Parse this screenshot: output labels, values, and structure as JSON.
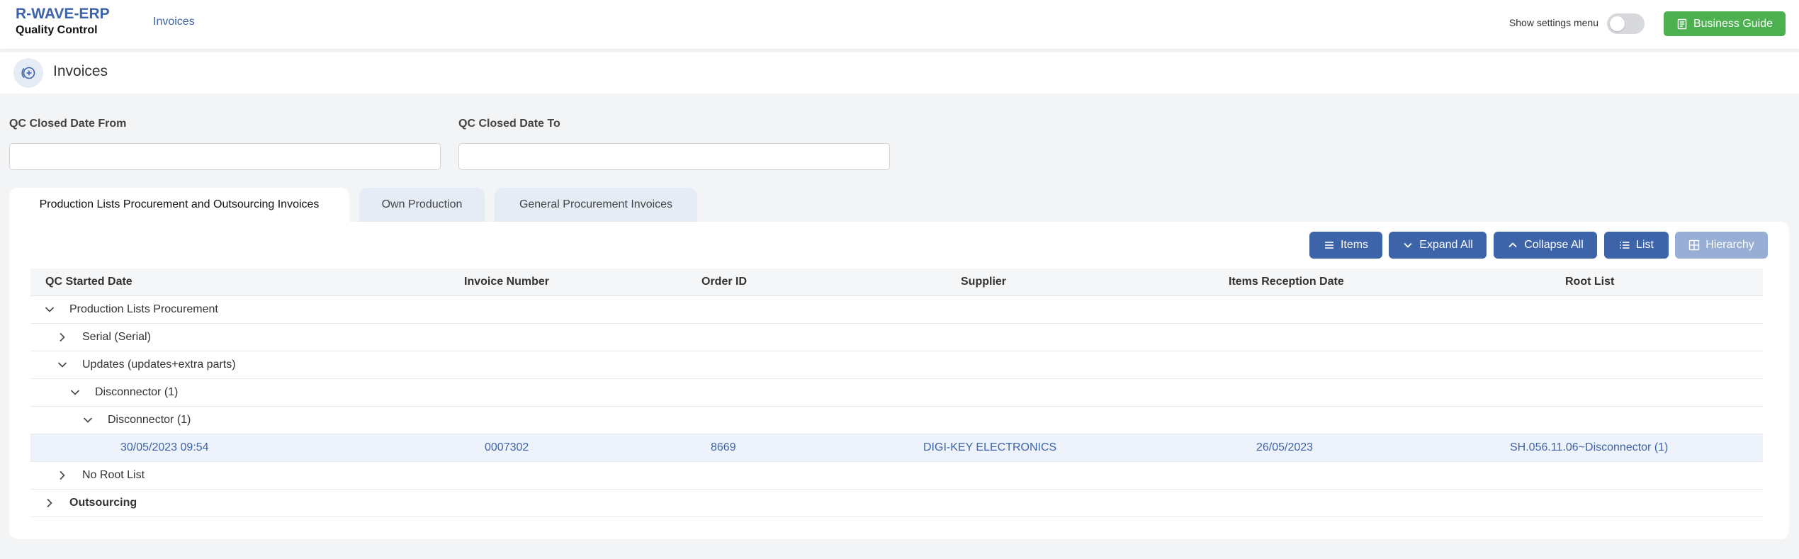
{
  "header": {
    "brand_name": "R-WAVE-ERP",
    "brand_sub": "Quality Control",
    "nav_invoices": "Invoices",
    "settings_label": "Show settings menu",
    "guide_button": "Business Guide"
  },
  "page": {
    "title": "Invoices"
  },
  "filters": {
    "date_from_label": "QC Closed Date From",
    "date_to_label": "QC Closed Date To",
    "date_from_value": "",
    "date_to_value": ""
  },
  "tabs": [
    {
      "label": "Production Lists Procurement and Outsourcing Invoices",
      "active": true
    },
    {
      "label": "Own Production",
      "active": false
    },
    {
      "label": "General Procurement Invoices",
      "active": false
    }
  ],
  "toolbar": {
    "items": "Items",
    "expand_all": "Expand All",
    "collapse_all": "Collapse All",
    "list": "List",
    "hierarchy": "Hierarchy"
  },
  "table": {
    "columns": [
      "QC Started Date",
      "Invoice Number",
      "Order ID",
      "Supplier",
      "Items Reception Date",
      "Root List"
    ],
    "groups": [
      {
        "label": "Production Lists Procurement",
        "expanded": true
      },
      {
        "label": "Serial (Serial)",
        "expanded": false
      },
      {
        "label": "Updates (updates+extra parts)",
        "expanded": true
      },
      {
        "label": "Disconnector (1)",
        "expanded": true
      },
      {
        "label": "Disconnector (1)",
        "expanded": true
      },
      {
        "label": "No Root List",
        "expanded": false
      },
      {
        "label": "Outsourcing",
        "expanded": false
      }
    ],
    "row": {
      "qc_started_date": "30/05/2023 09:54",
      "invoice_number": "0007302",
      "order_id": "8669",
      "supplier": "DIGI-KEY ELECTRONICS",
      "items_reception_date": "26/05/2023",
      "root_list": "SH.056.11.06~Disconnector (1)"
    }
  },
  "colors": {
    "primary": "#3d63a8",
    "success": "#4caf50",
    "disabled": "#98aed4"
  }
}
